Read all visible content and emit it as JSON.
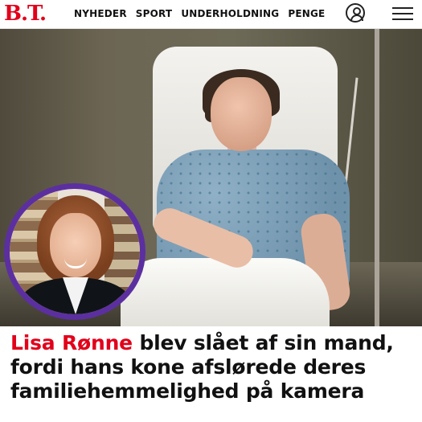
{
  "brand": {
    "logo_text": "B.T.",
    "color": "#e2001a"
  },
  "nav": {
    "items": [
      {
        "label": "NYHEDER"
      },
      {
        "label": "SPORT"
      },
      {
        "label": "UNDERHOLDNING"
      },
      {
        "label": "PENGE"
      }
    ],
    "user_icon": "user-icon",
    "menu_icon": "hamburger-menu-icon"
  },
  "article": {
    "headline_name": "Lisa Rønne",
    "headline_rest": " blev slået af sin mand, fordi hans kone afslørede deres familiehemmelighed på kamera",
    "name_color": "#e2001a",
    "avatar_ring_color": "#5c2fa0"
  }
}
